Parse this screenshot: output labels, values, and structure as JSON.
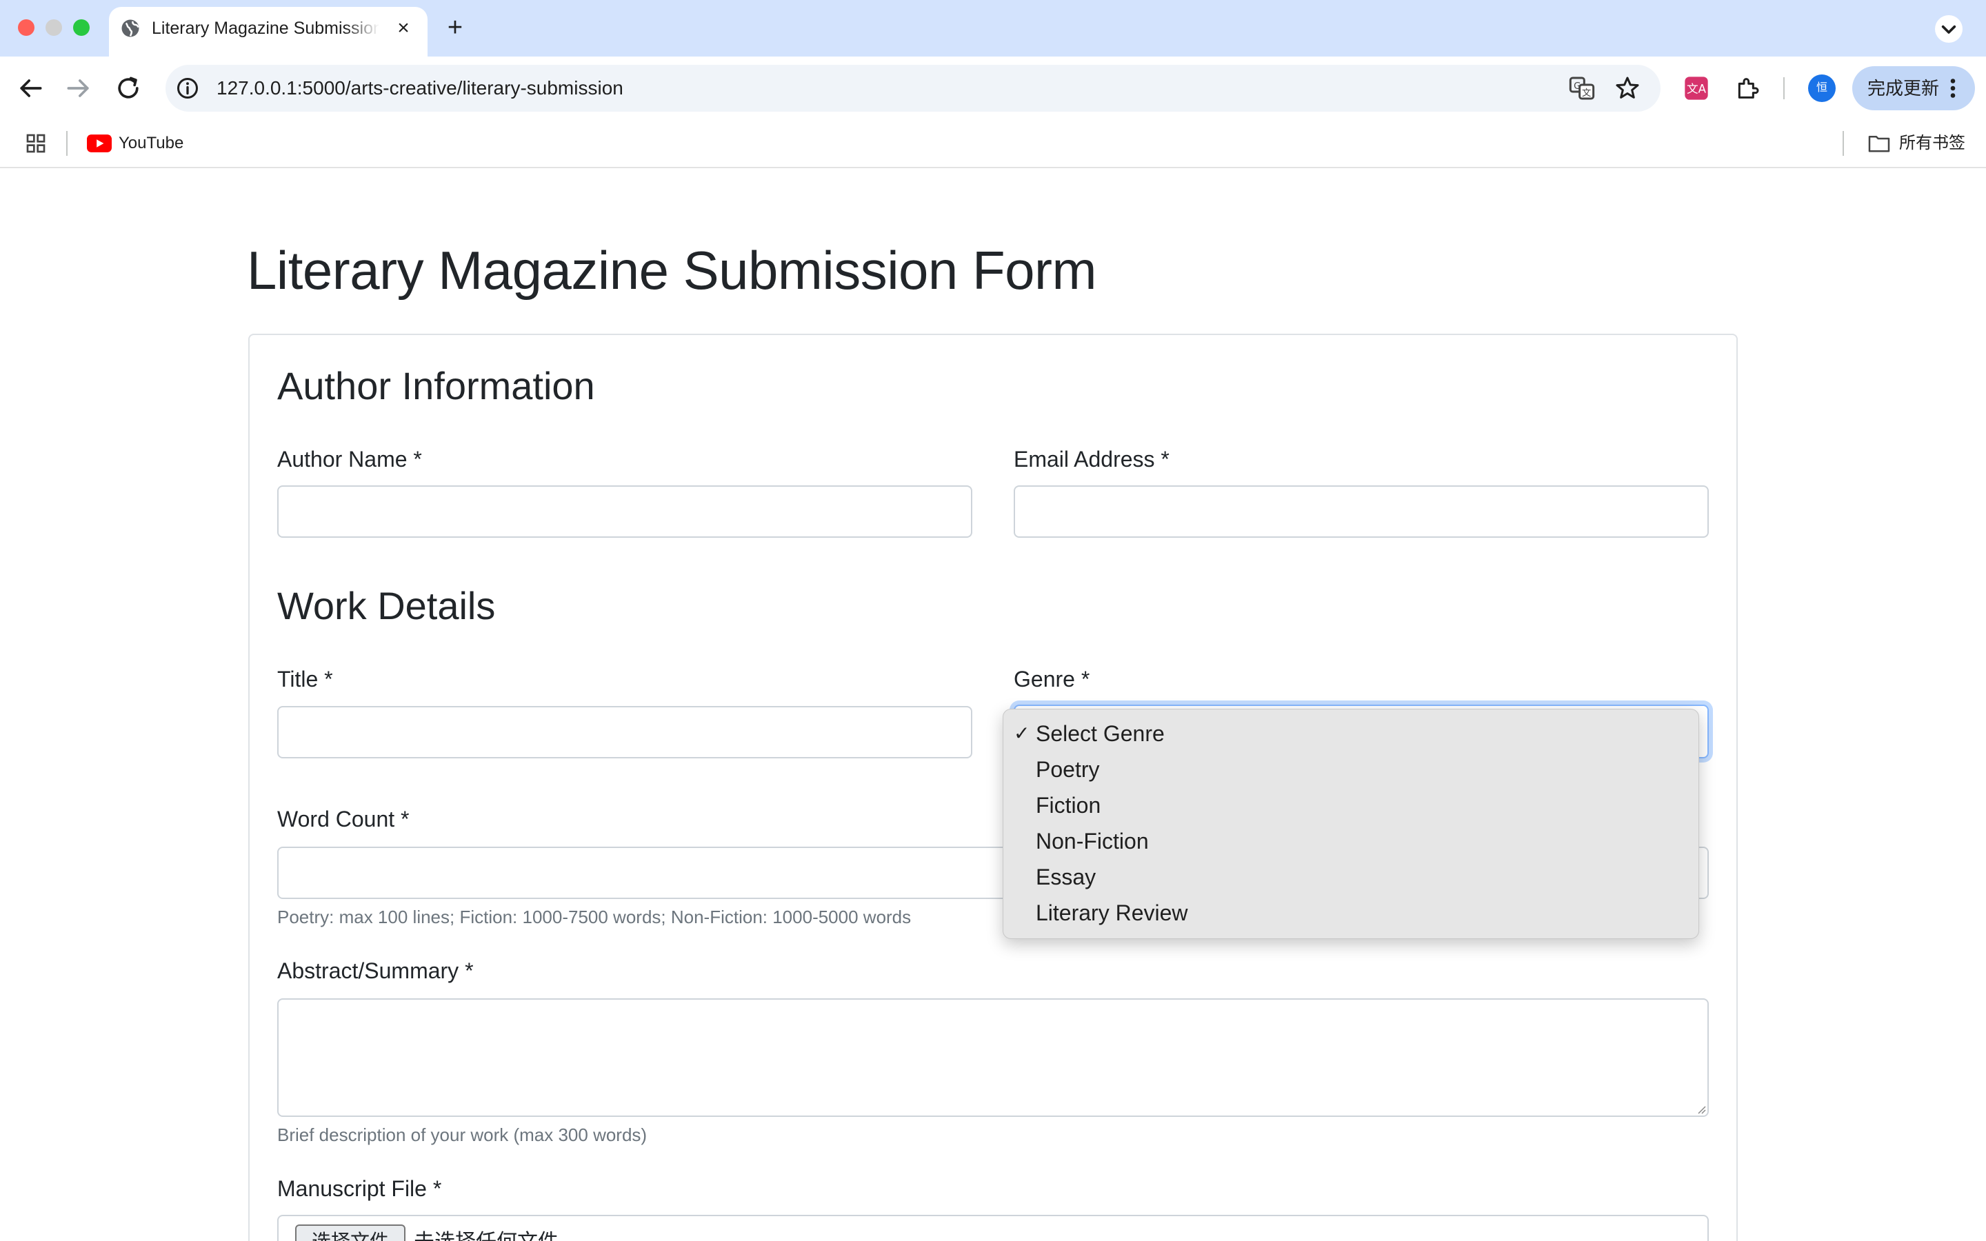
{
  "browser": {
    "tab_title": "Literary Magazine Submission Form",
    "new_tab_symbol": "+",
    "close_symbol": "×",
    "url": "127.0.0.1:5000/arts-creative/literary-submission",
    "avatar_initial": "恒",
    "update_button_label": "完成更新",
    "bookmarks": [
      {
        "label": "YouTube",
        "icon": "youtube-icon"
      }
    ],
    "all_bookmarks_label": "所有书签",
    "colors": {
      "tabbar": "#d3e3fd",
      "omnibox": "#f0f4f9",
      "update_button": "#c2d7f7"
    }
  },
  "page": {
    "title": "Literary Magazine Submission Form",
    "sections": {
      "author": "Author Information",
      "work": "Work Details"
    },
    "fields": {
      "author_name": {
        "label": "Author Name *",
        "value": ""
      },
      "email": {
        "label": "Email Address *",
        "value": ""
      },
      "title": {
        "label": "Title *",
        "value": ""
      },
      "genre": {
        "label": "Genre *",
        "selected": "Select Genre"
      },
      "word_count": {
        "label": "Word Count *",
        "value": "",
        "help": "Poetry: max 100 lines; Fiction: 1000-7500 words; Non-Fiction: 1000-5000 words"
      },
      "abstract": {
        "label": "Abstract/Summary *",
        "value": "",
        "help": "Brief description of your work (max 300 words)"
      },
      "manuscript": {
        "label": "Manuscript File *",
        "button_label": "选择文件",
        "status": "未选择任何文件"
      }
    },
    "colors": {
      "focus_border": "#86b7fe",
      "input_border": "#ced4da",
      "help_text": "#6c757d"
    }
  },
  "genre_dropdown": {
    "check_symbol": "✓",
    "options": [
      "Select Genre",
      "Poetry",
      "Fiction",
      "Non-Fiction",
      "Essay",
      "Literary Review"
    ],
    "selected_index": 0
  }
}
